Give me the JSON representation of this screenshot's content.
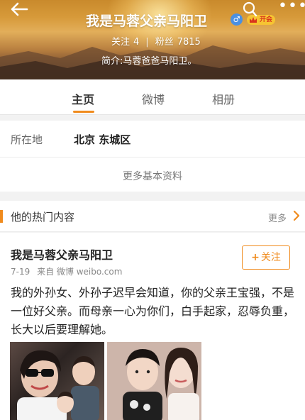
{
  "header": {
    "name": "我是马蓉父亲马阳卫",
    "gender_symbol": "♂",
    "vip_label": "开会",
    "stats": {
      "follow_label": "关注",
      "follow_count": "4",
      "separator": "|",
      "fans_label": "粉丝",
      "fans_count": "7815"
    },
    "bio": "简介:马蓉爸爸马阳卫。"
  },
  "tabs": [
    {
      "label": "主页",
      "active": true
    },
    {
      "label": "微博",
      "active": false
    },
    {
      "label": "相册",
      "active": false
    }
  ],
  "info": {
    "location_label": "所在地",
    "location_value": "北京 东城区",
    "more_info_link": "更多基本资料"
  },
  "hot": {
    "title": "他的热门内容",
    "more_label": "更多"
  },
  "post": {
    "author": "我是马蓉父亲马阳卫",
    "date": "7-19",
    "source": "来自 微博 weibo.com",
    "follow_label": "关注",
    "text": "我的外孙女、外孙子迟早会知道，你的父亲王宝强，不是一位好父亲。而母亲一心为你们，白手起家，忍辱负重，长大以后要理解她。"
  },
  "colors": {
    "accent": "#f08b1d",
    "gender_blue": "#4a90e2",
    "vip_gold": "#f6c432"
  },
  "icons": [
    "back-arrow-icon",
    "search-icon",
    "more-dots-icon",
    "gender-male-icon",
    "crown-icon",
    "chevron-right-icon"
  ]
}
